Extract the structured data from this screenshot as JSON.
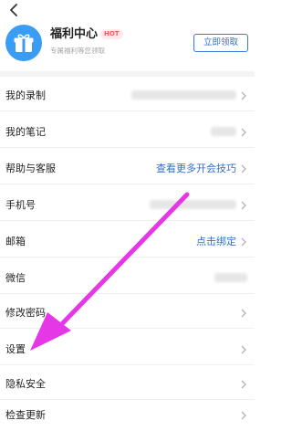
{
  "icons": {
    "back": "back-arrow-icon",
    "gift": "gift-icon",
    "chevron": "chevron-right-icon"
  },
  "colors": {
    "accent": "#2f6fc9",
    "gift_bg": "#3a9df5",
    "hot": "#f25a5a",
    "annotation_arrow": "#e637e6"
  },
  "banner": {
    "title": "福利中心",
    "badge": "HOT",
    "subtitle": "专属福利等您领取",
    "button": "立即领取"
  },
  "rows": [
    {
      "label": "我的录制",
      "value": "",
      "blurred": true
    },
    {
      "label": "我的笔记",
      "value": "",
      "blurred": true
    },
    {
      "label": "帮助与客服",
      "value": "查看更多开会技巧",
      "blurred": false
    },
    {
      "label": "手机号",
      "value": "",
      "blurred": true
    },
    {
      "label": "邮箱",
      "value": "点击绑定",
      "blurred": false
    },
    {
      "label": "微信",
      "value": "",
      "blurred": true
    },
    {
      "label": "修改密码",
      "value": "",
      "blurred": false
    },
    {
      "label": "设置",
      "value": "",
      "blurred": false
    },
    {
      "label": "隐私安全",
      "value": "",
      "blurred": false
    },
    {
      "label": "检查更新",
      "value": "",
      "blurred": false
    }
  ]
}
